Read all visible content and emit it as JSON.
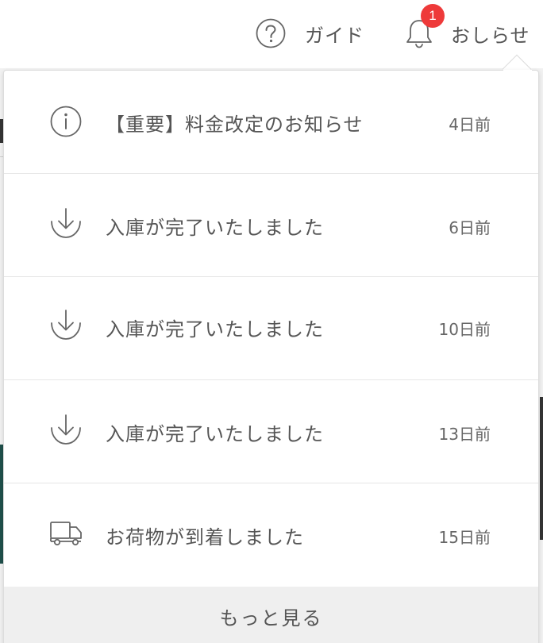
{
  "header": {
    "guide_label": "ガイド",
    "notifications_label": "おしらせ",
    "unread_count": "1",
    "badge_color": "#ee3a3a"
  },
  "notifications": {
    "items": [
      {
        "icon": "info-icon",
        "title": "【重要】料金改定のお知らせ",
        "time": "4日前"
      },
      {
        "icon": "download-icon",
        "title": "入庫が完了いたしました",
        "time": "6日前"
      },
      {
        "icon": "download-icon",
        "title": "入庫が完了いたしました",
        "time": "10日前"
      },
      {
        "icon": "download-icon",
        "title": "入庫が完了いたしました",
        "time": "13日前"
      },
      {
        "icon": "truck-icon",
        "title": "お荷物が到着しました",
        "time": "15日前"
      }
    ],
    "more_label": "もっと見る"
  }
}
